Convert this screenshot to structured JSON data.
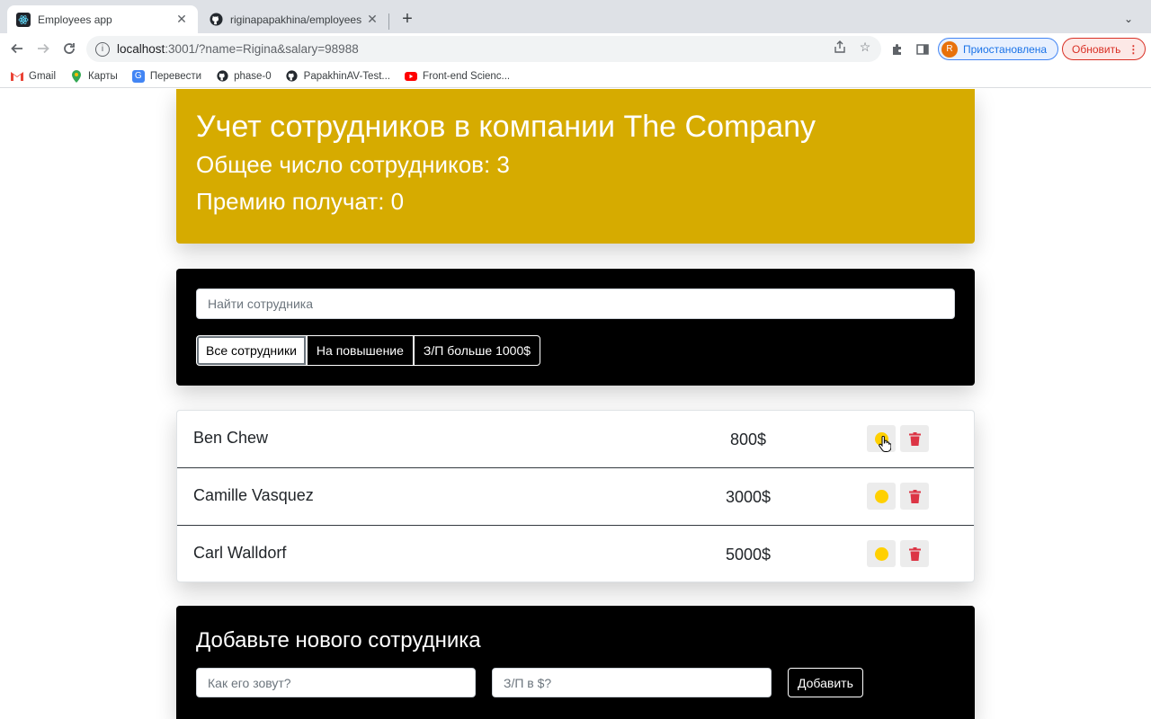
{
  "browser": {
    "tabs": [
      {
        "title": "Employees app",
        "active": true
      },
      {
        "title": "riginapapakhina/employees",
        "active": false
      }
    ],
    "url_host": "localhost",
    "url_path": ":3001/?name=Rigina&salary=98988",
    "profile_label": "Приостановлена",
    "profile_initial": "R",
    "update_label": "Обновить",
    "bookmarks": [
      "Gmail",
      "Карты",
      "Перевести",
      "phase-0",
      "PapakhinAV-Test...",
      "Front-end Scienc..."
    ]
  },
  "app_info": {
    "title": "Учет сотрудников в компании The Company",
    "total": "Общее число сотрудников: 3",
    "bonus": "Премию получат: 0"
  },
  "search": {
    "placeholder": "Найти сотрудника",
    "filters": [
      "Все сотрудники",
      "На повышение",
      "З/П больше 1000$"
    ],
    "active_filter": "Все сотрудники"
  },
  "employees": [
    {
      "name": "Ben Chew",
      "salary": "800$"
    },
    {
      "name": "Camille Vasquez",
      "salary": "3000$"
    },
    {
      "name": "Carl Walldorf",
      "salary": "5000$"
    }
  ],
  "add_form": {
    "title": "Добавьте нового сотрудника",
    "name_placeholder": "Как его зовут?",
    "salary_placeholder": "З/П в $?",
    "submit_label": "Добавить"
  },
  "colors": {
    "app_info_bg": "#d6ab00",
    "panel_bg": "#000000",
    "coin": "#ffd000",
    "trash": "#dc3545"
  }
}
